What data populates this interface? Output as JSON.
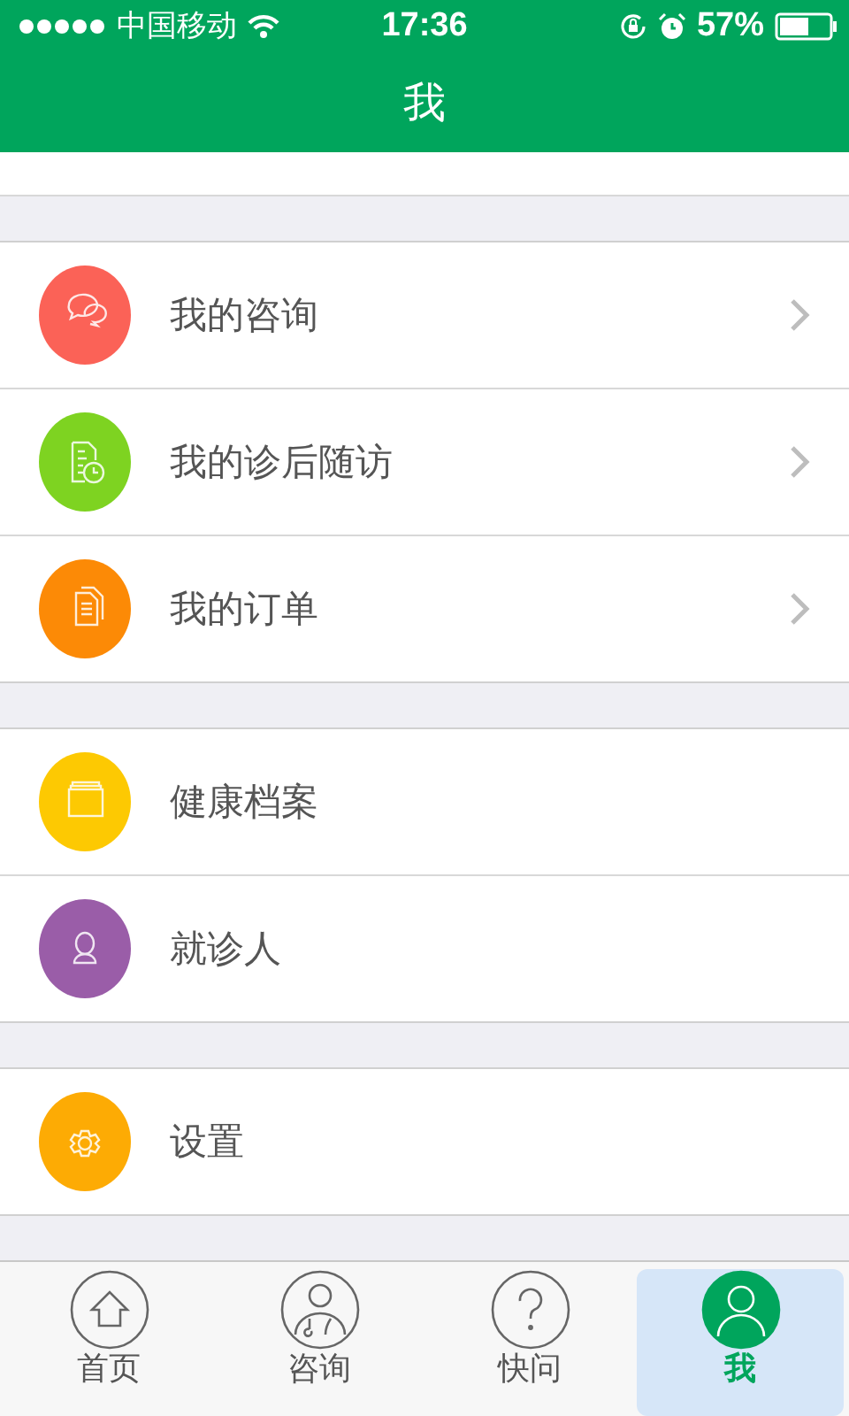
{
  "status_bar": {
    "carrier": "中国移动",
    "time": "17:36",
    "battery": "57%"
  },
  "header": {
    "title": "我"
  },
  "groups": [
    {
      "items": [
        {
          "label": "我的咨询",
          "kind": "chat",
          "color": "#fb6257",
          "chevron": true
        },
        {
          "label": "我的诊后随访",
          "kind": "report",
          "color": "#7ed321",
          "chevron": true
        },
        {
          "label": "我的订单",
          "kind": "documents",
          "color": "#fc8a06",
          "chevron": true
        }
      ]
    },
    {
      "items": [
        {
          "label": "健康档案",
          "kind": "folder",
          "color": "#fdc902",
          "chevron": false
        },
        {
          "label": "就诊人",
          "kind": "person",
          "color": "#9a5da8",
          "chevron": false
        }
      ]
    },
    {
      "items": [
        {
          "label": "设置",
          "kind": "gear",
          "color": "#fdab04",
          "chevron": false
        }
      ]
    }
  ],
  "tabs": [
    {
      "label": "首页",
      "kind": "home",
      "selected": false
    },
    {
      "label": "咨询",
      "kind": "doctor",
      "selected": false
    },
    {
      "label": "快问",
      "kind": "question",
      "selected": false
    },
    {
      "label": "我",
      "kind": "person",
      "selected": true
    }
  ]
}
